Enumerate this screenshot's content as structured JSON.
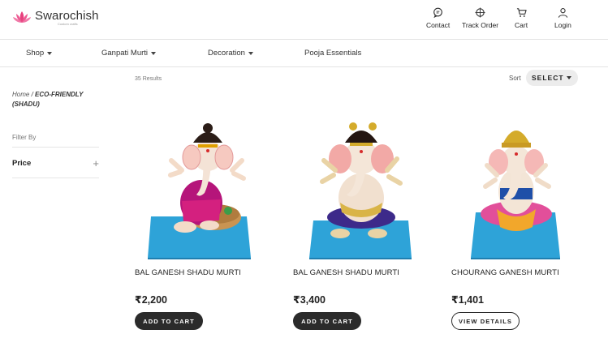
{
  "header": {
    "brand_name": "Swarochish",
    "brand_tagline": "Custom crafts",
    "nav": [
      {
        "label": "Contact",
        "icon": "chat-icon"
      },
      {
        "label": "Track Order",
        "icon": "crosshair-icon"
      },
      {
        "label": "Cart",
        "icon": "cart-icon"
      },
      {
        "label": "Login",
        "icon": "user-icon"
      }
    ]
  },
  "categories": [
    {
      "label": "Shop",
      "has_dropdown": true
    },
    {
      "label": "Ganpati Murti",
      "has_dropdown": true
    },
    {
      "label": "Decoration",
      "has_dropdown": true
    },
    {
      "label": "Pooja Essentials",
      "has_dropdown": false
    }
  ],
  "sidebar": {
    "breadcrumb_home": "Home",
    "breadcrumb_sep": " / ",
    "breadcrumb_current": "ECO-FRIENDLY (SHADU)",
    "filter_by": "Filter By",
    "price_filter": "Price"
  },
  "listing": {
    "results_count": "35 Results",
    "sort_label": "Sort",
    "sort_value": "SELECT"
  },
  "products": [
    {
      "name": "BAL GANESH SHADU MURTI",
      "price": "₹2,200",
      "button": "ADD TO CART",
      "button_style": "dark"
    },
    {
      "name": "BAL GANESH SHADU MURTI",
      "price": "₹3,400",
      "button": "ADD TO CART",
      "button_style": "dark"
    },
    {
      "name": "CHOURANG GANESH MURTI",
      "price": "₹1,401",
      "button": "VIEW DETAILS",
      "button_style": "outline"
    }
  ],
  "colors": {
    "brand_pink": "#e83e8c",
    "pedestal_blue": "#2ea3d8",
    "button_dark": "#2b2b2b"
  }
}
